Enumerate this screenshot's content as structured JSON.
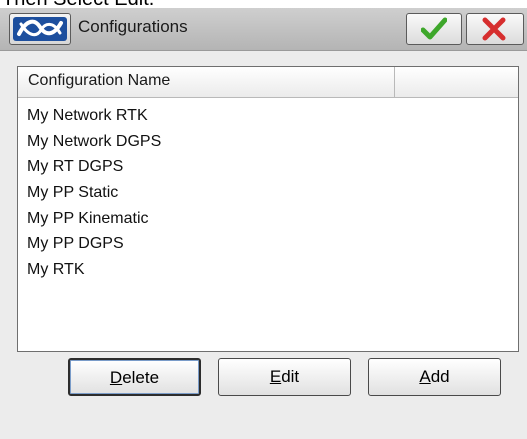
{
  "caption": "Then Select Edit.",
  "window": {
    "title": "Configurations",
    "ok_icon": "checkmark-icon",
    "cancel_icon": "close-x-icon",
    "logo_icon": "app-logo-icon"
  },
  "list": {
    "columns": [
      "Configuration Name",
      ""
    ],
    "items": [
      "My Network RTK",
      "My Network DGPS",
      "My RT DGPS",
      "My PP Static",
      "My PP Kinematic",
      "My PP DGPS",
      "My RTK"
    ]
  },
  "buttons": {
    "delete": {
      "accel": "D",
      "rest": "elete"
    },
    "edit": {
      "accel": "E",
      "rest": "dit"
    },
    "add": {
      "accel": "A",
      "rest": "dd"
    }
  },
  "colors": {
    "ok_green": "#3ea72b",
    "cancel_red": "#d62e2e",
    "logo_blue": "#1d4f9e"
  }
}
